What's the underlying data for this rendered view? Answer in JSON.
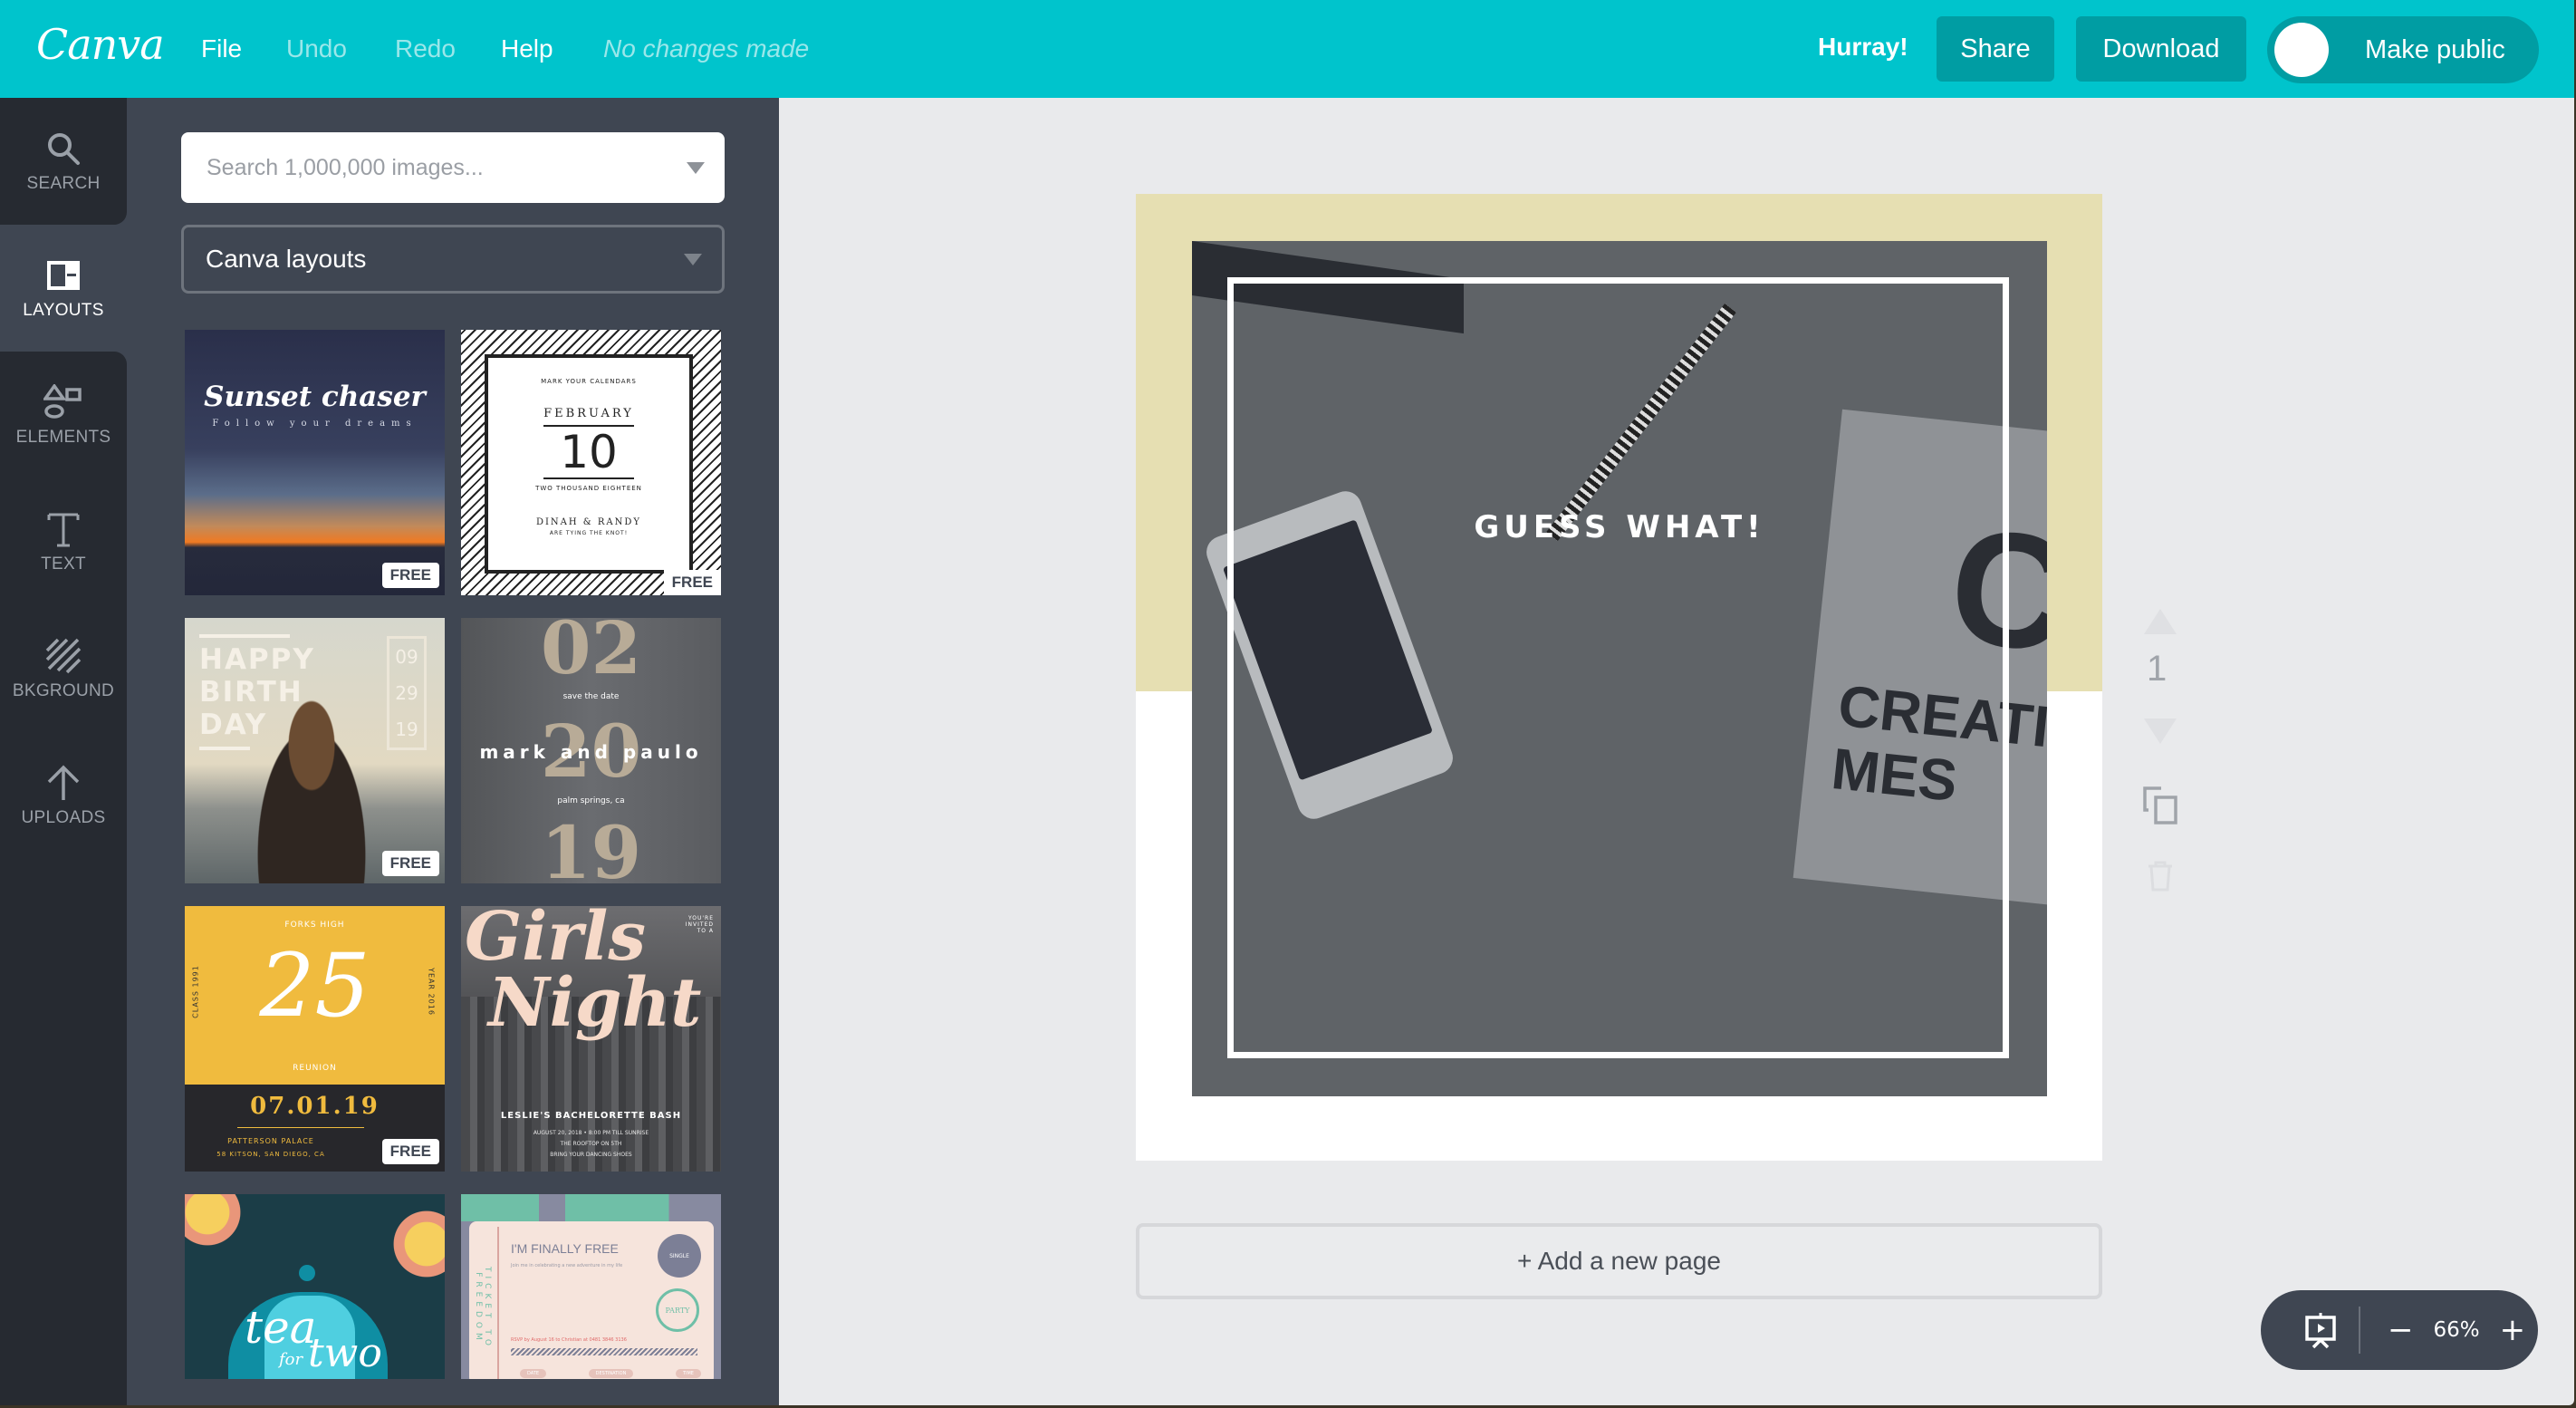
{
  "topbar": {
    "logo": "Canva",
    "menu": [
      "File",
      "Undo",
      "Redo",
      "Help"
    ],
    "status": "No changes made",
    "hurray": "Hurray!",
    "share": "Share",
    "download": "Download",
    "make_public": "Make public",
    "colors": {
      "bar": "#00c4cc",
      "button": "#009da3"
    }
  },
  "rail": {
    "items": [
      {
        "label": "SEARCH",
        "icon": "search-icon"
      },
      {
        "label": "LAYOUTS",
        "icon": "layouts-icon",
        "active": true
      },
      {
        "label": "ELEMENTS",
        "icon": "shapes-icon"
      },
      {
        "label": "TEXT",
        "icon": "text-icon"
      },
      {
        "label": "BKGROUND",
        "icon": "background-icon"
      },
      {
        "label": "UPLOADS",
        "icon": "upload-arrow-icon"
      }
    ]
  },
  "panel": {
    "search_placeholder": "Search 1,000,000 images...",
    "filter_selected": "Canva layouts",
    "free_badge": "FREE",
    "layouts": [
      {
        "name": "sunset-chaser",
        "title": "Sunset chaser",
        "subtitle": "Follow your dreams",
        "free": true
      },
      {
        "name": "february-10",
        "top": "MARK YOUR CALENDARS",
        "month": "FEBRUARY",
        "day": "10",
        "year": "TWO THOUSAND EIGHTEEN",
        "names": "DINAH & RANDY",
        "tag": "ARE TYING THE KNOT!",
        "free": true
      },
      {
        "name": "happy-birthday",
        "lines": [
          "HAPPY",
          "BIRTH",
          "DAY"
        ],
        "date": [
          "09",
          "29",
          "19"
        ],
        "free": true
      },
      {
        "name": "mark-and-paulo",
        "big": [
          "02",
          "20",
          "19"
        ],
        "save": "save the date",
        "names": "mark and paulo",
        "place": "palm springs, ca",
        "free": false
      },
      {
        "name": "reunion-25",
        "school": "FORKS HIGH",
        "number": "25",
        "left": "CLASS 1991",
        "right": "YEAR 2016",
        "label": "REUNION",
        "date": "07.01.19",
        "venue": "PATTERSON PALACE",
        "address": "58 KITSON, SAN DIEGO, CA",
        "free": true
      },
      {
        "name": "girls-night",
        "title1": "Girls",
        "title2": "Night",
        "invite": "YOU'RE INVITED TO A",
        "event": "LESLIE'S BACHELORETTE BASH",
        "details": [
          "AUGUST 20, 2018 • 8:00 PM TILL SUNRISE",
          "THE ROOFTOP ON 5TH",
          "BRING YOUR DANCING SHOES"
        ],
        "free": false
      },
      {
        "name": "tea-for-two",
        "t1": "tea",
        "t2": "for",
        "t3": "two",
        "free": false
      },
      {
        "name": "ticket-to-freedom",
        "side": "TICKET TO FREEDOM",
        "title": "I'M FINALLY FREE",
        "sub": "Join me in celebrating a new adventure in my life",
        "stamp1": "SINGLE",
        "stamp2": "PARTY",
        "rsvp": "RSVP by August 16 to Christian at 0481 3846 3136",
        "fields": [
          "DATE",
          "DESTINATION",
          "TIME"
        ],
        "free": false
      }
    ]
  },
  "canvas": {
    "headline": "GUESS WHAT!",
    "page_number": "1",
    "add_page": "+ Add a new page",
    "band_color": "#e6dfb2"
  },
  "zoom": {
    "level": "66%",
    "minus": "−",
    "plus": "+"
  }
}
